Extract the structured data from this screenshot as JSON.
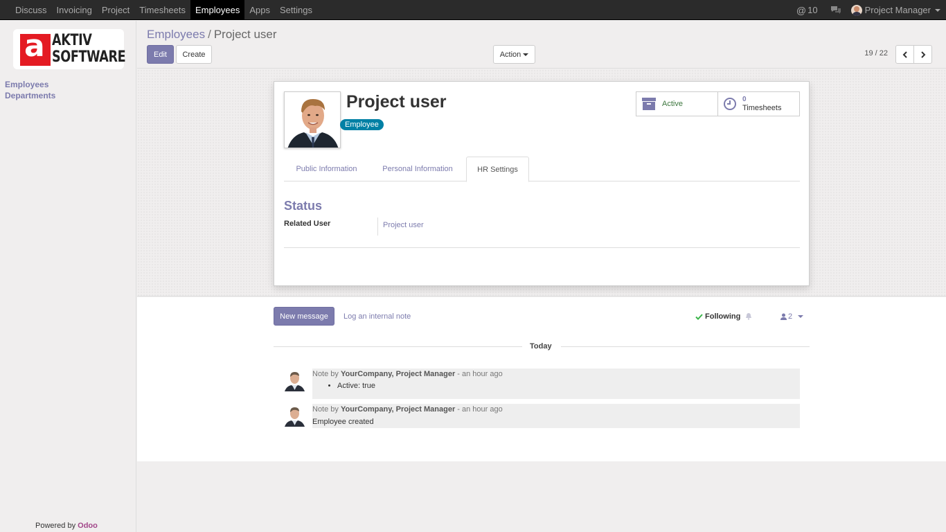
{
  "topbar": {
    "menu": [
      "Discuss",
      "Invoicing",
      "Project",
      "Timesheets",
      "Employees",
      "Apps",
      "Settings"
    ],
    "active_menu": "Employees",
    "mentions_count": "10",
    "user_name": "Project Manager"
  },
  "sidebar": {
    "logo_line1": "AKTIV",
    "logo_line2": "SOFTWARE",
    "logo_letter": "a",
    "links": [
      "Employees",
      "Departments"
    ],
    "powered_by": "Powered by",
    "powered_brand": "Odoo"
  },
  "control": {
    "breadcrumb_parent": "Employees",
    "breadcrumb_sep": "/",
    "breadcrumb_current": "Project user",
    "edit_label": "Edit",
    "create_label": "Create",
    "action_label": "Action",
    "pager": "19 / 22"
  },
  "employee": {
    "name": "Project user",
    "tag": "Employee",
    "active_label": "Active",
    "timesheets_count": "0",
    "timesheets_label": "Timesheets"
  },
  "tabs": [
    "Public Information",
    "Personal Information",
    "HR Settings"
  ],
  "active_tab": "HR Settings",
  "hr_settings": {
    "section_title": "Status",
    "related_user_label": "Related User",
    "related_user_value": "Project user"
  },
  "chatter": {
    "new_message": "New message",
    "log_note": "Log an internal note",
    "following": "Following",
    "followers_count": "2",
    "day_separator": "Today",
    "messages": [
      {
        "prefix": "Note by",
        "author": "YourCompany, Project Manager",
        "time": "- an hour ago",
        "body": "Active: true",
        "is_list": true
      },
      {
        "prefix": "Note by",
        "author": "YourCompany, Project Manager",
        "time": "- an hour ago",
        "body": "Employee created",
        "is_list": false
      }
    ]
  },
  "colors": {
    "accent": "#7c7bad",
    "topbar": "#2b2b2b",
    "tag": "#0180a5",
    "active_green": "#3c763d",
    "brand_red": "#e41b23",
    "odoo": "#a24689"
  }
}
